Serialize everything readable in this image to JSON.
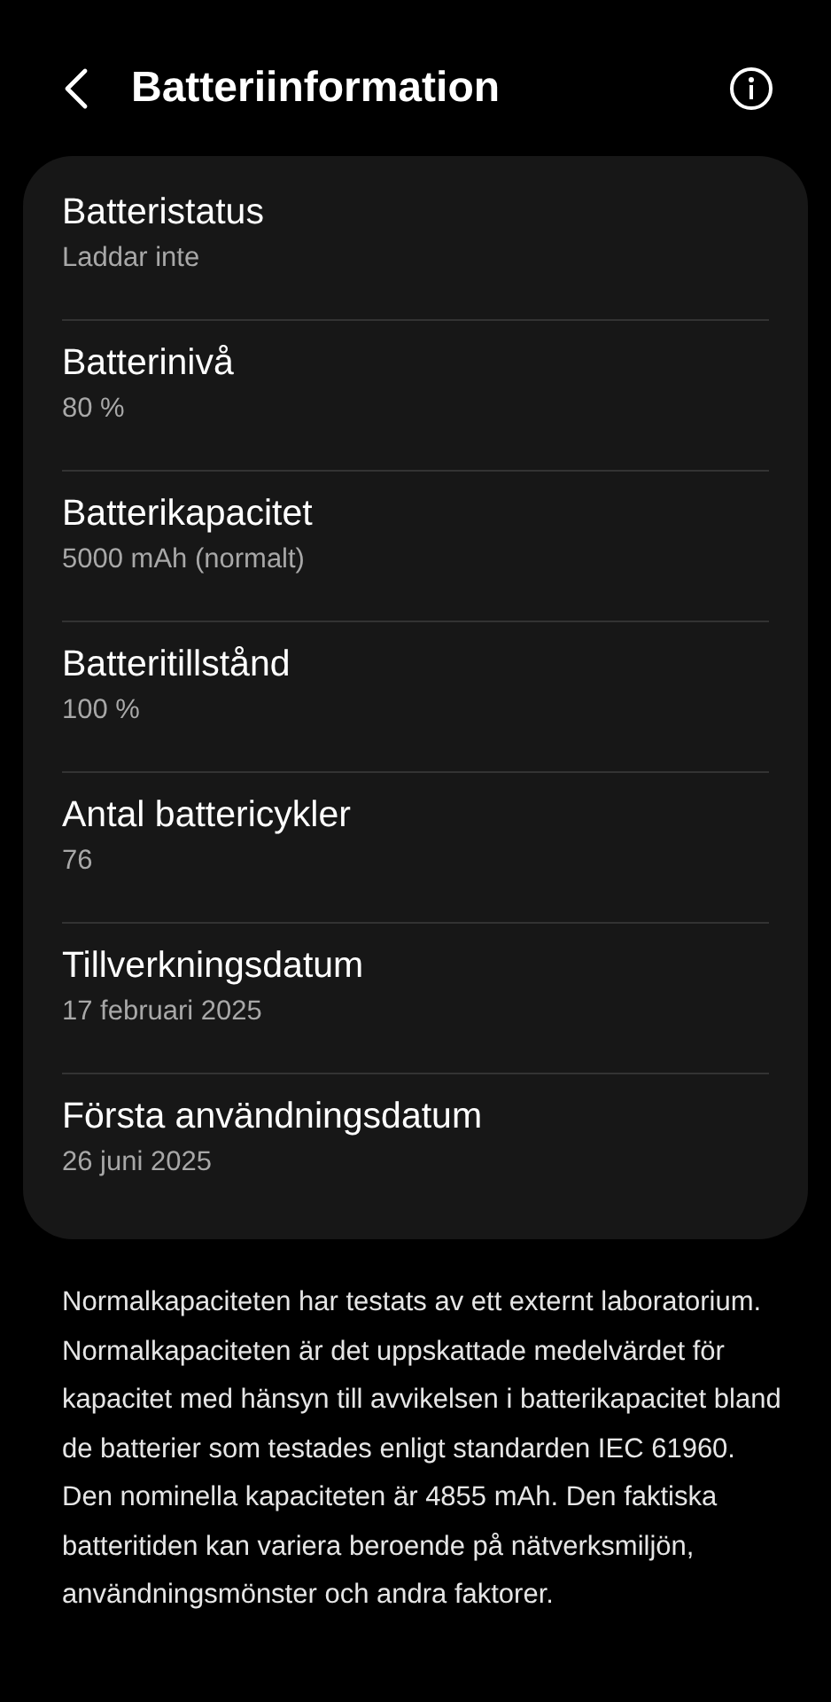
{
  "header": {
    "title": "Batteriinformation"
  },
  "items": [
    {
      "label": "Batteristatus",
      "value": "Laddar inte"
    },
    {
      "label": "Batterinivå",
      "value": "80 %"
    },
    {
      "label": "Batterikapacitet",
      "value": "5000 mAh (normalt)"
    },
    {
      "label": "Batteritillstånd",
      "value": "100 %"
    },
    {
      "label": "Antal battericykler",
      "value": "76"
    },
    {
      "label": "Tillverkningsdatum",
      "value": "17 februari 2025"
    },
    {
      "label": "Första användningsdatum",
      "value": "26 juni 2025"
    }
  ],
  "footnote": "Normalkapaciteten har testats av ett externt laboratorium. Normalkapaciteten är det uppskattade medelvärdet för kapacitet med hänsyn till avvikelsen i batterikapacitet bland de batterier som testades enligt standarden IEC 61960. Den nominella kapaciteten är 4855 mAh. Den faktiska batteritiden kan variera beroende på nätverksmiljön, användningsmönster och andra faktorer."
}
